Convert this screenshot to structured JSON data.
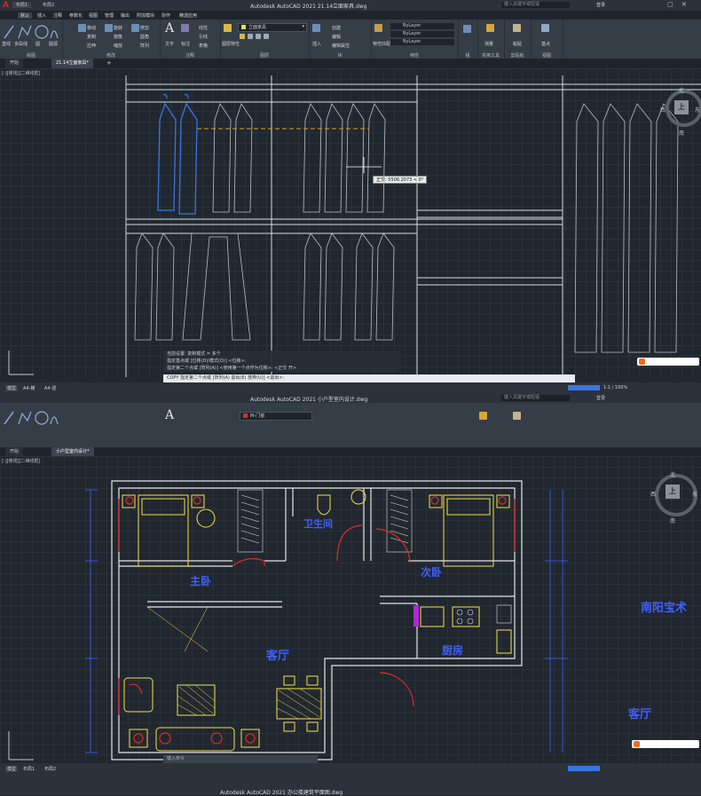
{
  "top_window": {
    "title": "Autodesk AutoCAD 2021    21.14立面家具.dwg",
    "search_placeholder": "键入关键字或短语",
    "login": "登录",
    "file_tabs": [
      "布局1",
      "布局2"
    ],
    "menu_tabs": [
      "默认",
      "插入",
      "注释",
      "参数化",
      "视图",
      "管理",
      "输出",
      "附加模块",
      "协作",
      "精选应用"
    ],
    "groups": [
      {
        "label": "绘图",
        "items": [
          "直线",
          "多段线",
          "圆",
          "圆弧"
        ]
      },
      {
        "label": "修改",
        "items": [
          "移动",
          "旋转",
          "修剪",
          "复制",
          "镜像",
          "圆角",
          "拉伸",
          "缩放",
          "阵列"
        ]
      },
      {
        "label": "注释",
        "items": [
          "文字",
          "标注",
          "线性",
          "引线",
          "表格"
        ]
      },
      {
        "label": "图层",
        "items": [
          "图层特性",
          "立面家具"
        ]
      },
      {
        "label": "块",
        "items": [
          "插入",
          "创建",
          "编辑",
          "编辑属性"
        ]
      },
      {
        "label": "特性",
        "items": [
          "特性匹配",
          "ByLayer",
          "ByLayer",
          "ByLayer"
        ]
      },
      {
        "label": "组",
        "items": [
          "组"
        ]
      },
      {
        "label": "实用工具",
        "items": [
          "测量"
        ]
      },
      {
        "label": "剪贴板",
        "items": [
          "粘贴"
        ]
      },
      {
        "label": "视图",
        "items": [
          "基点"
        ]
      }
    ],
    "doc_tabs": [
      "开始",
      "21.14立面家具*"
    ],
    "viewport_label": "[-][俯视][二维线框]",
    "tooltip": "正交: 5506.2073 < 0°",
    "compass": {
      "center": "上",
      "north": "北",
      "south": "南",
      "west": "西",
      "east": "东"
    },
    "cmd_history": [
      "当前设置: 复制模式 = 多个",
      "指定基点或 [位移(D)/模式(O)] <位移>:",
      "指定第二个点或 [阵列(A)] <使用第一个点作为位移>: <正交 开>"
    ],
    "cmd_line": "COPY 指定第二个点或 [阵列(A) 退出(E) 放弃(U)] <退出>:",
    "layout_tabs": [
      "模型",
      "A4-横",
      "A4-竖"
    ],
    "zoom": "1:1 / 100%"
  },
  "bottom_window": {
    "title": "Autodesk AutoCAD 2021    小户型室内设计.dwg",
    "search_placeholder": "键入关键字或短语",
    "login": "登录",
    "layer_name": "M-门窗",
    "doc_tabs": [
      "开始",
      "小户型室内设计*"
    ],
    "viewport_label": "[-][俯视][二维线框]",
    "rooms": [
      "卫生间",
      "主卧",
      "次卧",
      "客厅",
      "厨房"
    ],
    "side_text_1": "南阳宝术",
    "side_text_2": "客厅",
    "compass": {
      "center": "上",
      "north": "北",
      "south": "南",
      "west": "西",
      "east": "东"
    },
    "cmd_placeholder": "键入命令",
    "layout_tabs": [
      "模型",
      "布局1",
      "布局2"
    ],
    "footer_title": "Autodesk AutoCAD 2021    办公楼建筑平面图.dwg"
  },
  "colors": {
    "accent_blue": "#3f5fff",
    "yellow": "#f2e04b",
    "red": "#e02a2a",
    "wall": "#e6e6e6",
    "select": "#3c74e0",
    "logo": "#d8261d"
  }
}
